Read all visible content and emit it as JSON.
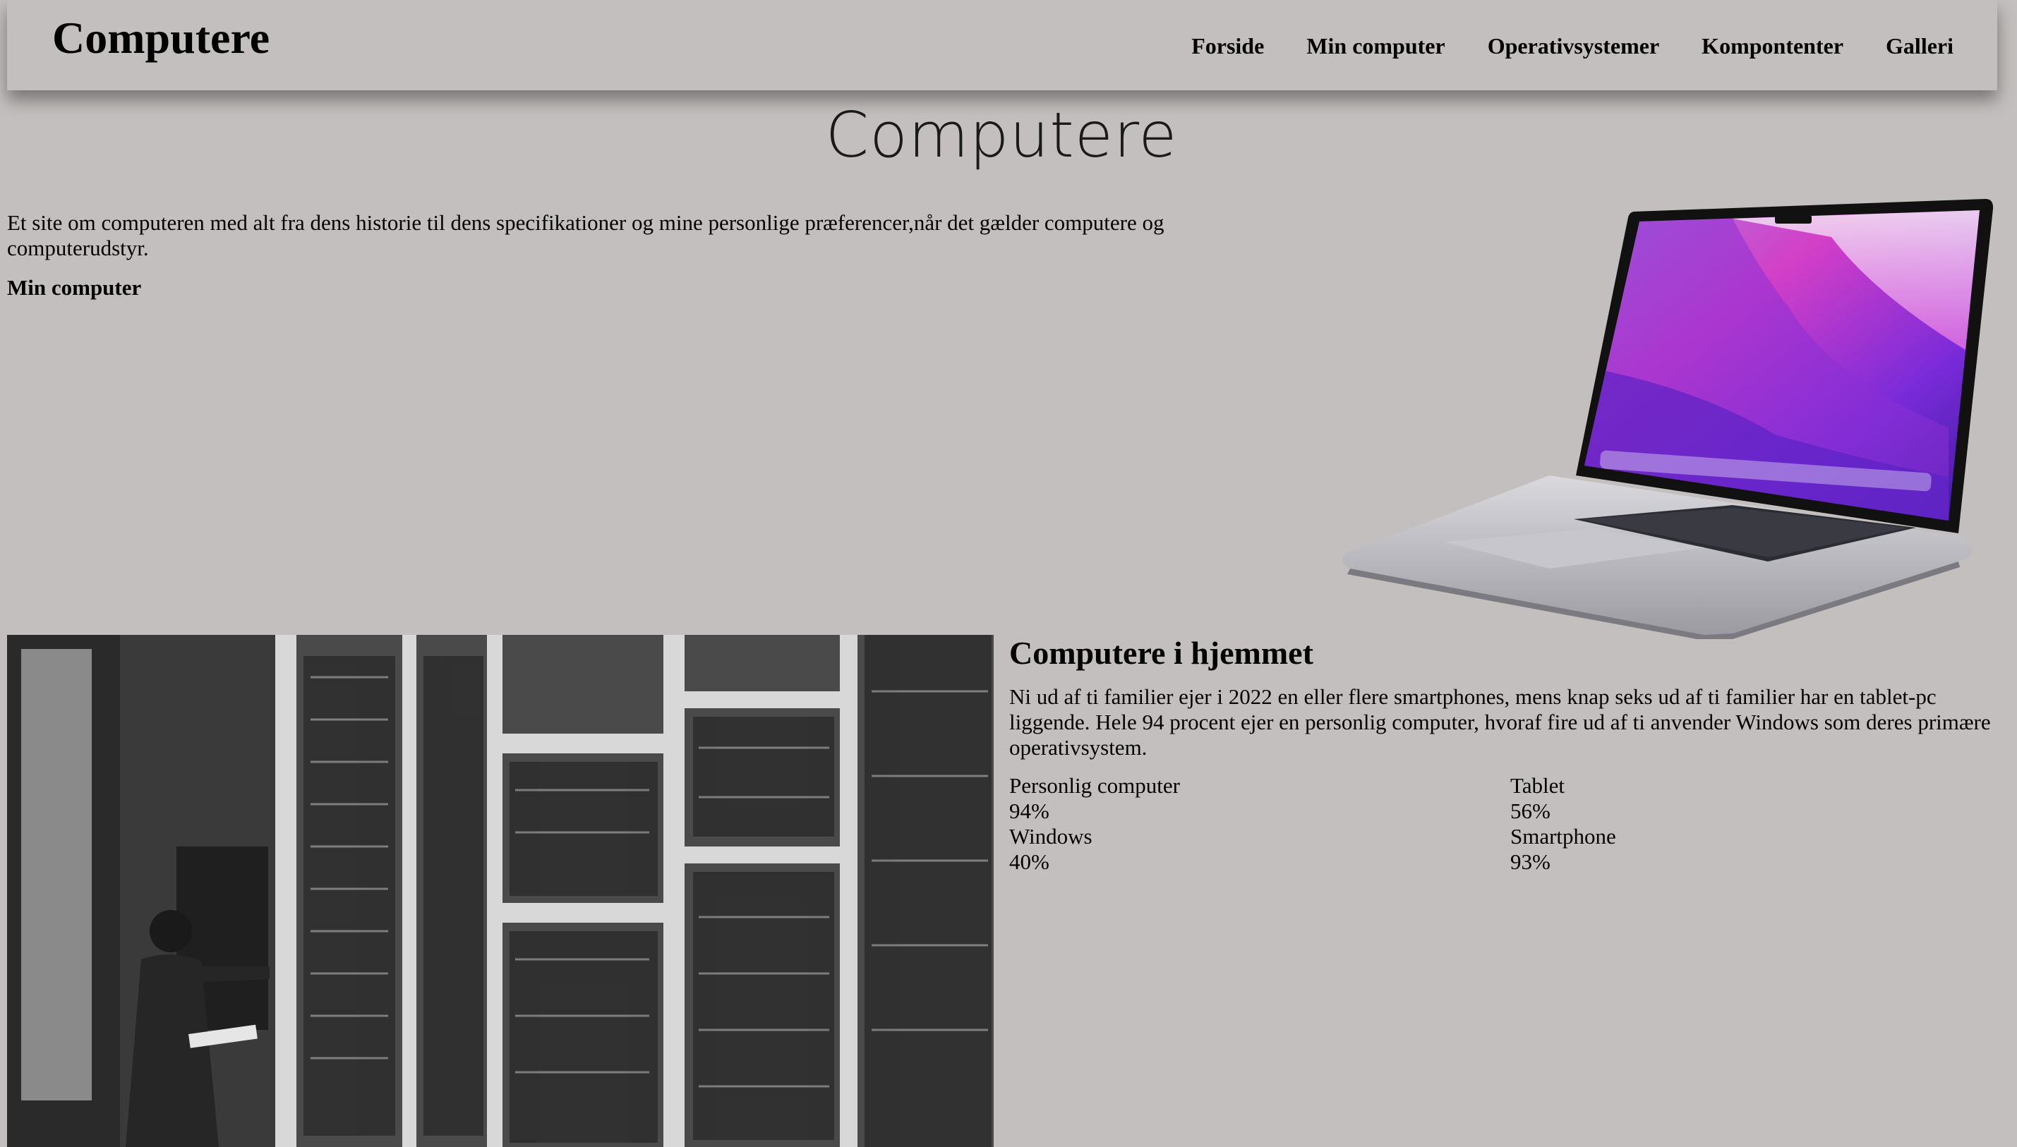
{
  "header": {
    "brand": "Computere",
    "nav": [
      {
        "label": "Forside"
      },
      {
        "label": "Min computer"
      },
      {
        "label": "Operativsystemer"
      },
      {
        "label": "Kompontenter"
      },
      {
        "label": "Galleri"
      }
    ]
  },
  "hero": {
    "title": "Computere"
  },
  "intro": {
    "text": "Et site om computeren med alt fra dens historie til dens specifikationer og mine personlige præferencer,når det gælder computere og computerudstyr.",
    "link_label": "Min computer"
  },
  "article": {
    "heading": "Computere i hjemmet",
    "body": "Ni ud af ti familier ejer i 2022 en eller flere smartphones, mens knap seks ud af ti familier har en tablet-pc liggende. Hele 94 procent ejer en personlig computer, hvoraf fire ud af ti anvender Windows som deres primære operativsystem.",
    "stats": [
      {
        "label": "Personlig computer",
        "value": "94%"
      },
      {
        "label": "Tablet",
        "value": "56%"
      },
      {
        "label": "Windows",
        "value": "40%"
      },
      {
        "label": "Smartphone",
        "value": "93%"
      }
    ]
  },
  "images": {
    "laptop": "laptop-image",
    "vintage_computer": "vintage-computer-photo"
  },
  "colors": {
    "background": "#c3bfbe",
    "text": "#000000"
  }
}
